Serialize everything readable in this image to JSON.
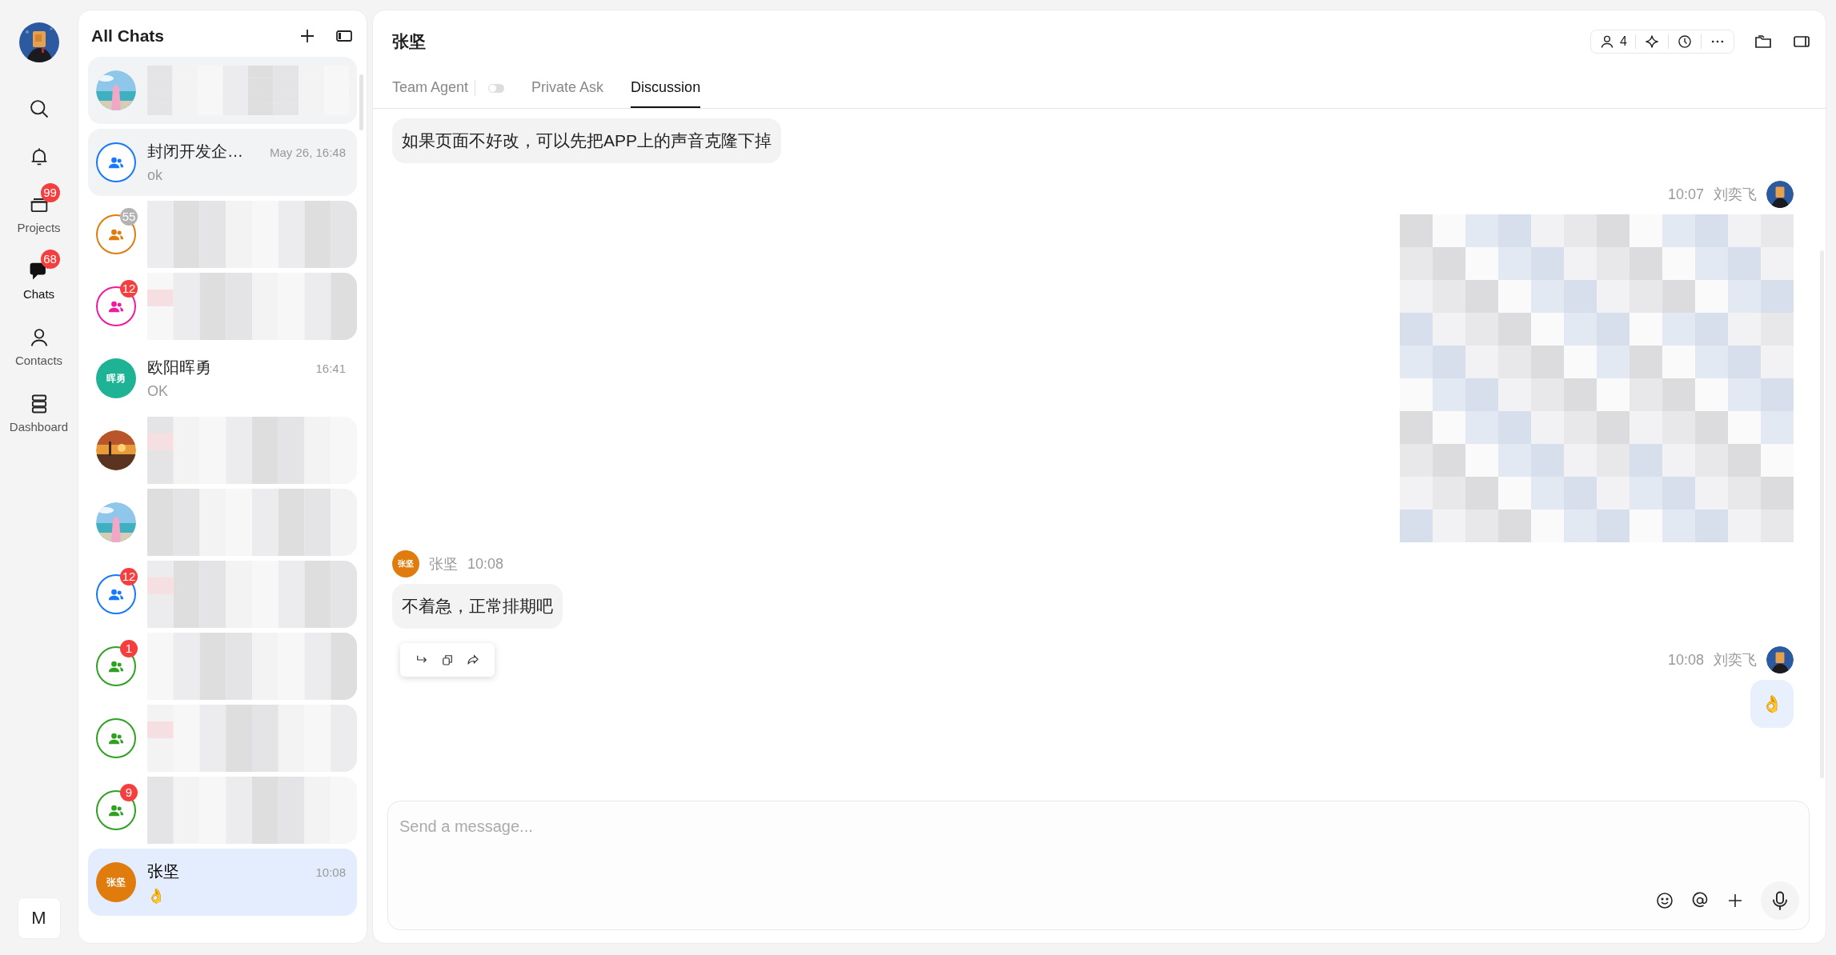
{
  "nav": {
    "items": [
      {
        "kind": "search",
        "selected": false
      },
      {
        "kind": "bell",
        "selected": false
      },
      {
        "kind": "projects",
        "label": "Projects",
        "badge": "99",
        "selected": false
      },
      {
        "kind": "chats",
        "label": "Chats",
        "badge": "68",
        "selected": true
      },
      {
        "kind": "contacts",
        "label": "Contacts",
        "selected": false
      },
      {
        "kind": "dashboard",
        "label": "Dashboard",
        "selected": false
      }
    ],
    "bottom_button": "M"
  },
  "chat_list": {
    "title": "All Chats",
    "chats": [
      {
        "kind": "picture",
        "blurred": true,
        "pinned": true,
        "selected": false
      },
      {
        "kind": "group",
        "color": "#1677ff",
        "name": "封闭开发企…",
        "time": "May 26, 16:48",
        "preview": "ok",
        "pinned": true,
        "selected": false
      },
      {
        "kind": "group",
        "color": "#e07b0e",
        "badge": "55",
        "badge_muted": true,
        "blurred": true,
        "pinned": false,
        "selected": false
      },
      {
        "kind": "group",
        "color": "#f01aa0",
        "badge": "12",
        "badge_muted": false,
        "blurred": true,
        "pinned": false,
        "selected": false
      },
      {
        "kind": "initials",
        "color": "#1db394",
        "initials": "晖勇",
        "name": "欧阳晖勇",
        "time": "16:41",
        "preview": "OK",
        "pinned": false,
        "selected": false
      },
      {
        "kind": "picture",
        "blurred": true,
        "pinned": false,
        "selected": false
      },
      {
        "kind": "picture",
        "blurred": true,
        "pinned": false,
        "selected": false
      },
      {
        "kind": "group",
        "color": "#1677ff",
        "badge": "12",
        "badge_muted": false,
        "blurred": true,
        "pinned": false,
        "selected": false
      },
      {
        "kind": "group",
        "color": "#2ea121",
        "badge": "1",
        "badge_muted": false,
        "blurred": true,
        "pinned": false,
        "selected": false
      },
      {
        "kind": "group",
        "color": "#2ea121",
        "blurred": true,
        "pinned": false,
        "selected": false
      },
      {
        "kind": "group",
        "color": "#2ea121",
        "badge": "9",
        "badge_muted": false,
        "blurred": true,
        "pinned": false,
        "selected": false
      },
      {
        "kind": "initials",
        "color": "#e07b0e",
        "initials": "张坚",
        "name": "张坚",
        "time": "10:08",
        "preview": "👌",
        "pinned": false,
        "selected": true
      }
    ]
  },
  "conversation": {
    "title": "张坚",
    "member_count": "4",
    "tabs": [
      {
        "label": "Team Agent",
        "selected": false,
        "kind": "toggle",
        "toggle_on": false
      },
      {
        "label": "Private Ask",
        "selected": false,
        "kind": "plain"
      },
      {
        "label": "Discussion",
        "selected": true,
        "kind": "plain"
      }
    ],
    "messages": [
      {
        "outgoing": false,
        "kind": "text",
        "text": "如果页面不好改，可以先把APP上的声音克隆下掉"
      },
      {
        "outgoing": true,
        "kind": "blurred",
        "sender": "刘奕飞",
        "time": "10:07"
      },
      {
        "outgoing": false,
        "kind": "text",
        "sender": "张坚",
        "initials": "张坚",
        "time": "10:08",
        "text": "不着急，正常排期吧",
        "actions": true
      },
      {
        "outgoing": true,
        "kind": "text",
        "sender": "刘奕飞",
        "time": "10:08",
        "text": "👌"
      }
    ],
    "input": {
      "placeholder": "Send a message..."
    }
  }
}
